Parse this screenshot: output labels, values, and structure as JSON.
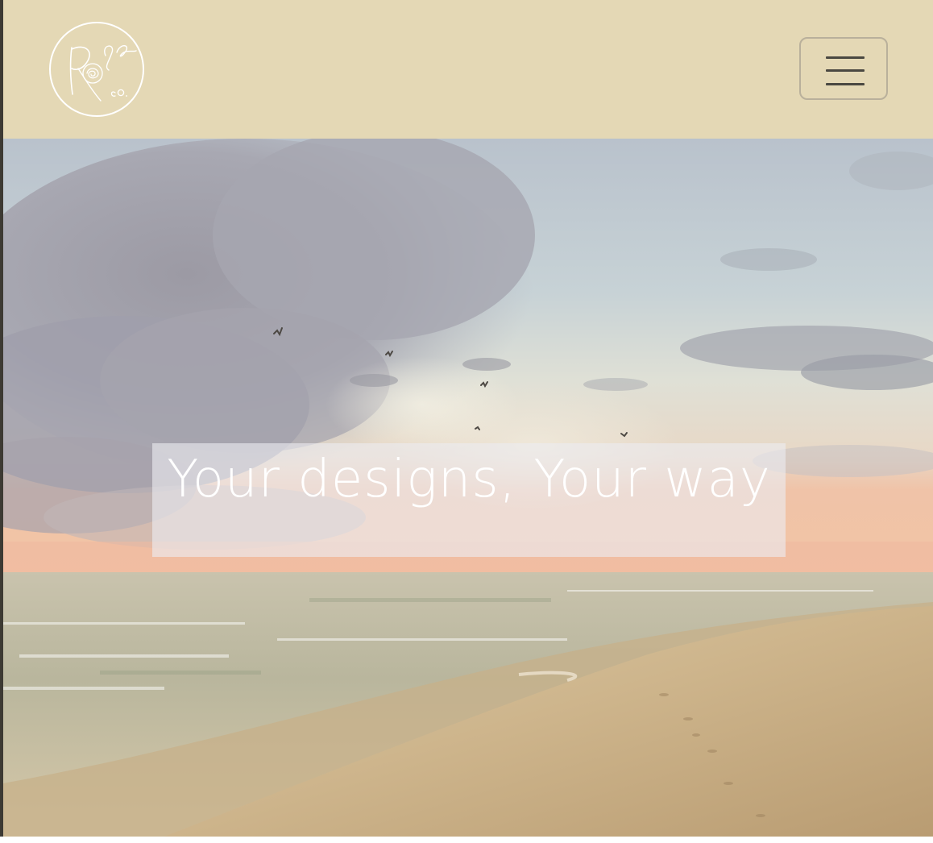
{
  "navbar": {
    "background": "#e4d8b5",
    "logo": {
      "icon": "rose-logo-icon",
      "label": "Rose Co. logo"
    },
    "menu_button": {
      "icon": "hamburger-menu-icon",
      "label": "Toggle navigation"
    }
  },
  "hero": {
    "background": "beach-sunset-photo",
    "caption": "Your designs, Your way"
  }
}
